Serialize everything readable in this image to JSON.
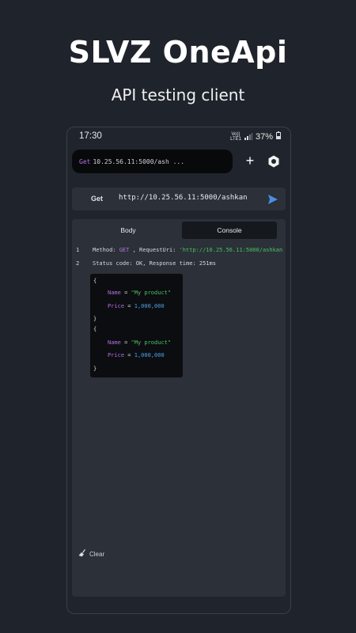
{
  "hero": {
    "title": "SLVZ OneApi",
    "subtitle": "API testing client"
  },
  "status_bar": {
    "time": "17:30",
    "volte_top": "Vo))",
    "volte_bottom": "LTE1",
    "battery": "37%"
  },
  "toolbar": {
    "tab": {
      "method": "Get",
      "url": "10.25.56.11:5000/ash ..."
    },
    "add_label": "+"
  },
  "request": {
    "method": "Get",
    "url": "http://10.25.56.11:5000/ashkan"
  },
  "tabs": {
    "body": "Body",
    "console": "Console"
  },
  "console": {
    "line1": {
      "num": "1",
      "method_label": "Method: ",
      "method": "GET",
      "sep": " , RequestUri: ",
      "uri": "'http://10.25.56.11:5000/ashkan"
    },
    "line2": {
      "num": "2",
      "text": "Status code: OK, Response time: 251ms"
    },
    "json": {
      "open1": "{",
      "name_key1": "Name",
      "eq1": " = ",
      "name_val1": "\"My product\"",
      "price_key1": "Price",
      "eq2": " = ",
      "price_val1": "1,000,000",
      "close1": "}",
      "open2": "{",
      "name_key2": "Name",
      "eq3": " = ",
      "name_val2": "\"My product\"",
      "price_key2": "Price",
      "eq4": " = ",
      "price_val2": "1,000,000",
      "close2": "}"
    }
  },
  "clear_label": "Clear",
  "colors": {
    "background": "#1e232c",
    "accent_blue": "#4a8fe0",
    "method_purple": "#b470e0",
    "string_green": "#4cc260"
  }
}
